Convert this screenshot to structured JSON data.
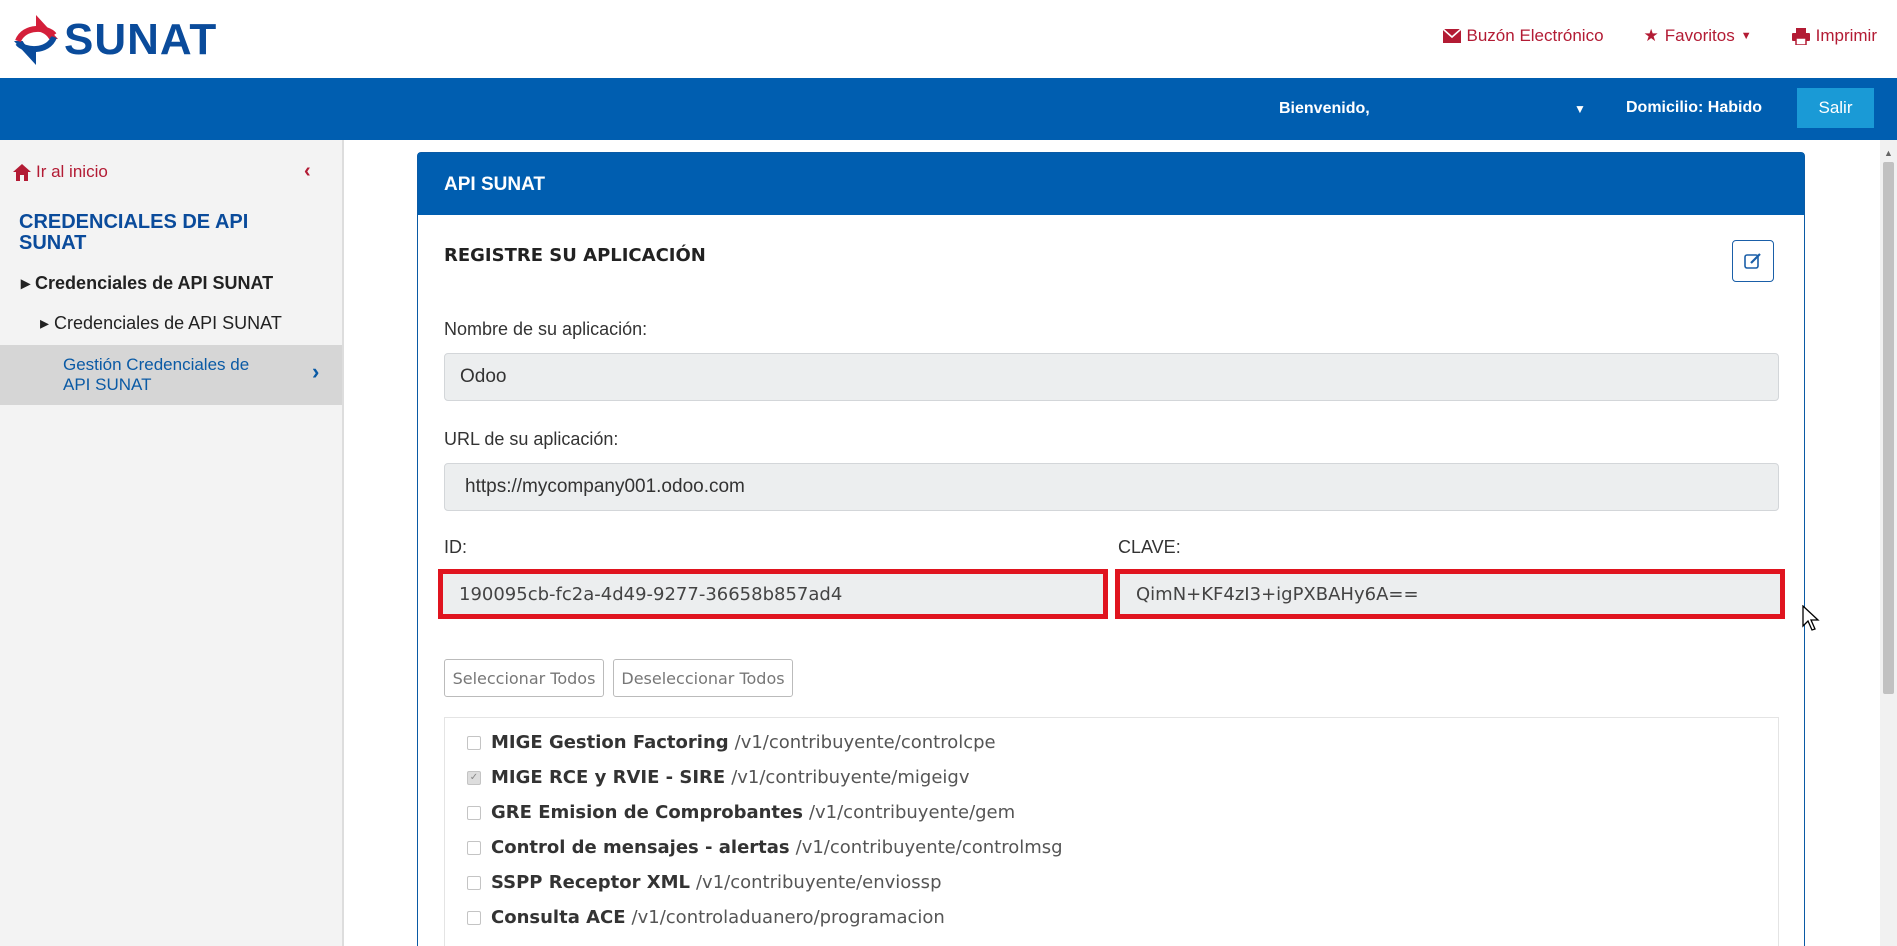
{
  "header": {
    "logo_text": "SUNAT",
    "links": [
      {
        "label": "Buzón Electrónico",
        "icon": "envelope-icon"
      },
      {
        "label": "Favoritos",
        "icon": "star-icon"
      },
      {
        "label": "Imprimir",
        "icon": "printer-icon"
      }
    ]
  },
  "navbar": {
    "welcome": "Bienvenido,",
    "domicilio": "Domicilio: Habido",
    "logout": "Salir"
  },
  "sidebar": {
    "home": "Ir al inicio",
    "title": "CREDENCIALES DE API SUNAT",
    "item1": "Credenciales de API SUNAT",
    "item2": "Credenciales de API SUNAT",
    "active": "Gestión Credenciales de API SUNAT"
  },
  "panel": {
    "title": "API SUNAT",
    "section": "REGISTRE SU APLICACIÓN",
    "name_label": "Nombre de su aplicación:",
    "name_value": "Odoo",
    "url_label": "URL de su aplicación:",
    "url_value": "https://mycompany001.odoo.com",
    "id_label": "ID:",
    "id_value": "190095cb-fc2a-4d49-9277-36658b857ad4",
    "key_label": "CLAVE:",
    "key_value": "QimN+KF4zI3+igPXBAHy6A==",
    "select_all": "Seleccionar Todos",
    "deselect_all": "Deseleccionar Todos"
  },
  "apis": [
    {
      "name": "MIGE Gestion Factoring",
      "path": "/v1/contribuyente/controlcpe",
      "checked": false
    },
    {
      "name": "MIGE RCE y RVIE - SIRE",
      "path": "/v1/contribuyente/migeigv",
      "checked": true
    },
    {
      "name": "GRE Emision de Comprobantes",
      "path": "/v1/contribuyente/gem",
      "checked": false
    },
    {
      "name": "Control de mensajes - alertas",
      "path": "/v1/contribuyente/controlmsg",
      "checked": false
    },
    {
      "name": "SSPP Receptor XML",
      "path": "/v1/contribuyente/enviossp",
      "checked": false
    },
    {
      "name": "Consulta ACE",
      "path": "/v1/controladuanero/programacion",
      "checked": false
    }
  ],
  "colors": {
    "brand_blue": "#005eb0",
    "brand_red": "#b31b34",
    "highlight": "#e0141f",
    "logout_button": "#1a9ad6"
  }
}
